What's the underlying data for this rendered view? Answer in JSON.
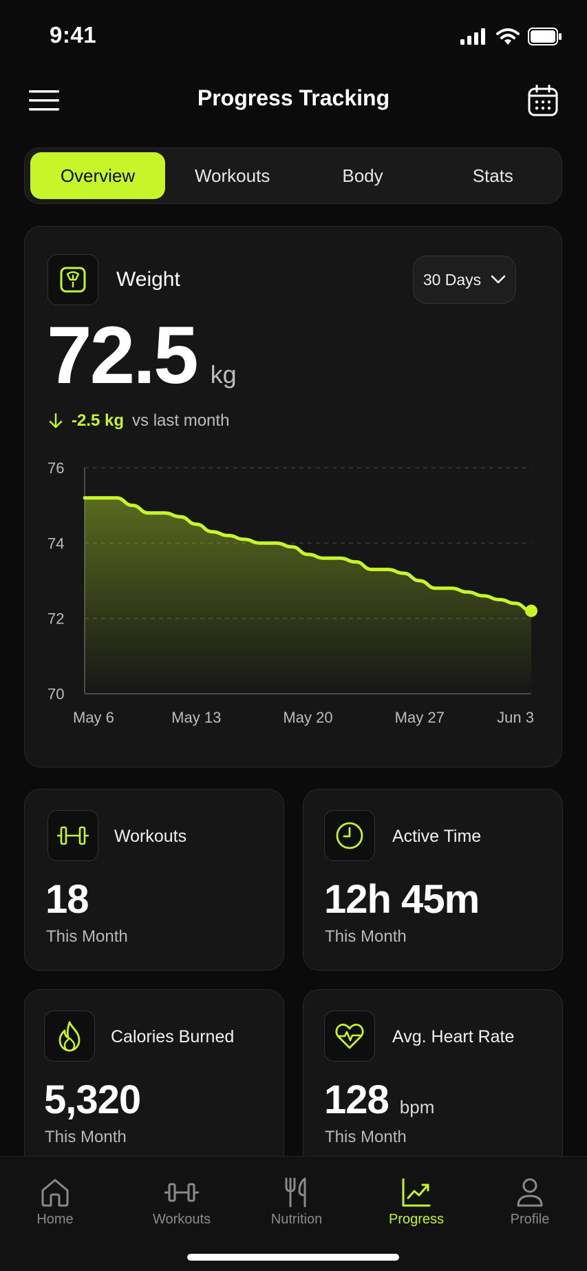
{
  "status_bar": {
    "time": "9:41"
  },
  "header": {
    "title": "Progress Tracking"
  },
  "tabs": [
    {
      "label": "Overview",
      "active": true
    },
    {
      "label": "Workouts",
      "active": false
    },
    {
      "label": "Body",
      "active": false
    },
    {
      "label": "Stats",
      "active": false
    }
  ],
  "weight": {
    "label": "Weight",
    "range": "30 Days",
    "value": "72.5",
    "unit": "kg",
    "change": "-2.5 kg",
    "change_suffix": "vs last month"
  },
  "chart_data": {
    "type": "area",
    "x": [
      "May 6",
      "May 7",
      "May 8",
      "May 9",
      "May 10",
      "May 11",
      "May 12",
      "May 13",
      "May 14",
      "May 15",
      "May 16",
      "May 17",
      "May 18",
      "May 19",
      "May 20",
      "May 21",
      "May 22",
      "May 23",
      "May 24",
      "May 25",
      "May 26",
      "May 27",
      "May 28",
      "May 29",
      "May 30",
      "May 31",
      "Jun 1",
      "Jun 2",
      "Jun 3"
    ],
    "series": [
      {
        "values": [
          75.2,
          75.2,
          75.2,
          75.0,
          74.8,
          74.8,
          74.7,
          74.5,
          74.3,
          74.2,
          74.1,
          74.0,
          74.0,
          73.9,
          73.7,
          73.6,
          73.6,
          73.5,
          73.3,
          73.3,
          73.2,
          73.0,
          72.8,
          72.8,
          72.7,
          72.6,
          72.5,
          72.4,
          72.2
        ]
      }
    ],
    "x_ticks": [
      "May 6",
      "May 13",
      "May 20",
      "May 27",
      "Jun 3"
    ],
    "y_ticks": [
      76,
      74,
      72,
      70
    ],
    "ylim": [
      70,
      76
    ],
    "grid": true,
    "accent_color": "#c6f52a"
  },
  "stats": [
    {
      "icon": "dumbbell-icon",
      "label": "Workouts",
      "value": "18",
      "unit": "",
      "sub": "This Month"
    },
    {
      "icon": "clock-icon",
      "label": "Active Time",
      "value": "12h 45m",
      "unit": "",
      "sub": "This Month"
    },
    {
      "icon": "flame-icon",
      "label": "Calories Burned",
      "value": "5,320",
      "unit": "",
      "sub": "This Month"
    },
    {
      "icon": "heart-rate-icon",
      "label": "Avg. Heart Rate",
      "value": "128",
      "unit": "bpm",
      "sub": "This Month"
    }
  ],
  "nav": [
    {
      "label": "Home",
      "icon": "home-icon",
      "active": false
    },
    {
      "label": "Workouts",
      "icon": "dumbbell-icon",
      "active": false
    },
    {
      "label": "Nutrition",
      "icon": "fork-knife-icon",
      "active": false
    },
    {
      "label": "Progress",
      "icon": "chart-icon",
      "active": true
    },
    {
      "label": "Profile",
      "icon": "user-icon",
      "active": false
    }
  ],
  "colors": {
    "accent": "#c6f52a",
    "background": "#0b0b0b",
    "card": "#161616"
  }
}
